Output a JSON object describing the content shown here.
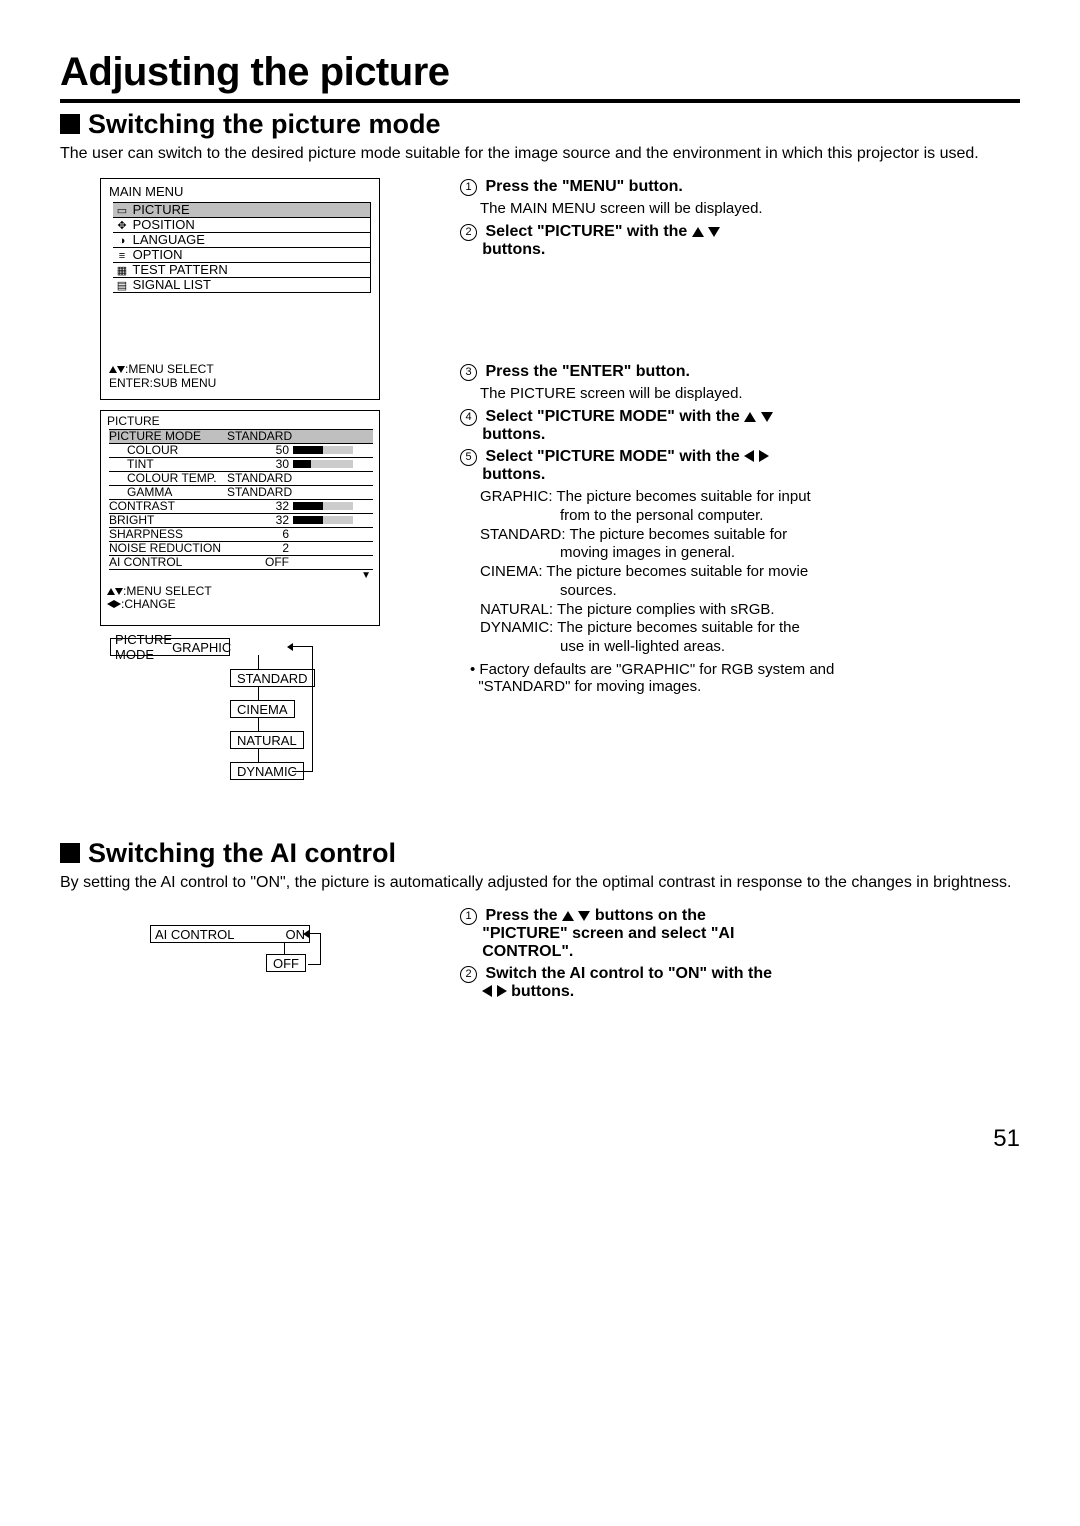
{
  "page_title": "Adjusting the picture",
  "section1": {
    "heading": "Switching the picture mode",
    "intro": "The user can switch to the desired picture mode suitable for the image source and the environment in which this projector is used."
  },
  "main_menu": {
    "title": "MAIN MENU",
    "items": [
      "PICTURE",
      "POSITION",
      "LANGUAGE",
      "OPTION",
      "TEST PATTERN",
      "SIGNAL LIST"
    ],
    "hint1": ":MENU SELECT",
    "hint2": "ENTER:SUB MENU"
  },
  "picture_menu": {
    "title": "PICTURE",
    "rows": [
      {
        "label": "PICTURE MODE",
        "value": "STANDARD",
        "indent": false,
        "bar": null,
        "sel": true
      },
      {
        "label": "COLOUR",
        "value": "50",
        "indent": true,
        "bar": 50
      },
      {
        "label": "TINT",
        "value": "30",
        "indent": true,
        "bar": 30
      },
      {
        "label": "COLOUR TEMP.",
        "value": "STANDARD",
        "indent": true,
        "bar": null
      },
      {
        "label": "GAMMA",
        "value": "STANDARD",
        "indent": true,
        "bar": null
      },
      {
        "label": "CONTRAST",
        "value": "32",
        "indent": false,
        "bar": 50
      },
      {
        "label": "BRIGHT",
        "value": "32",
        "indent": false,
        "bar": 50
      },
      {
        "label": "SHARPNESS",
        "value": "6",
        "indent": false,
        "bar": null
      },
      {
        "label": "NOISE REDUCTION",
        "value": "2",
        "indent": false,
        "bar": null
      },
      {
        "label": "AI CONTROL",
        "value": "OFF",
        "indent": false,
        "bar": null
      }
    ],
    "hint1": ":MENU SELECT",
    "hint2": ":CHANGE"
  },
  "mode_diagram": {
    "label": "PICTURE MODE",
    "current": "GRAPHIC",
    "options": [
      "STANDARD",
      "CINEMA",
      "NATURAL",
      "DYNAMIC"
    ]
  },
  "steps1": {
    "s1": "Press the \"MENU\" button.",
    "s1sub": "The MAIN MENU screen will be displayed.",
    "s2a": "Select \"PICTURE\" with the ",
    "s2b": "buttons.",
    "s3": "Press the \"ENTER\" button.",
    "s3sub": "The PICTURE screen will be displayed.",
    "s4a": "Select \"PICTURE MODE\" with the ",
    "s4b": "buttons.",
    "s5a": "Select \"PICTURE MODE\" with the ",
    "s5b": "buttons.",
    "desc_graphic_a": "GRAPHIC: The picture becomes suitable for input",
    "desc_graphic_b": "from to the personal computer.",
    "desc_standard_a": "STANDARD: The picture becomes suitable for",
    "desc_standard_b": "moving images in general.",
    "desc_cinema_a": "CINEMA: The picture becomes suitable for movie",
    "desc_cinema_b": "sources.",
    "desc_natural": "NATURAL: The picture complies with sRGB.",
    "desc_dynamic_a": "DYNAMIC: The picture becomes suitable for the",
    "desc_dynamic_b": "use in well-lighted areas.",
    "bullet_a": "• Factory defaults are \"GRAPHIC\" for RGB system and",
    "bullet_b": "\"STANDARD\" for moving images."
  },
  "section2": {
    "heading": "Switching the AI control",
    "intro": "By setting the AI control to \"ON\", the picture is automatically adjusted for the optimal contrast in response to the changes in brightness."
  },
  "ai_diagram": {
    "label": "AI CONTROL",
    "current": "ON",
    "opt": "OFF"
  },
  "steps2": {
    "s1a": "Press the ",
    "s1b": " buttons on the",
    "s1c": "\"PICTURE\" screen and select \"AI",
    "s1d": "CONTROL\".",
    "s2a": "Switch the AI control to \"ON\" with the",
    "s2b": " buttons."
  },
  "page_number": "51"
}
